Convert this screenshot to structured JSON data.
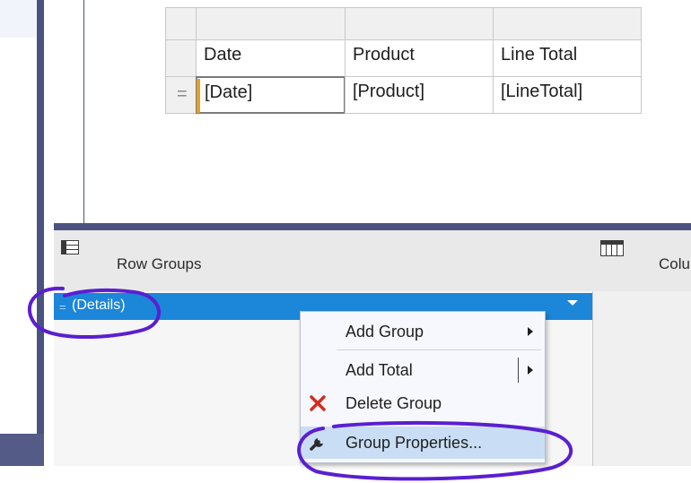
{
  "tablix": {
    "headers": [
      "Date",
      "Product",
      "Line Total"
    ],
    "row": [
      "[Date]",
      "[Product]",
      "[LineTotal]"
    ],
    "row_handle_glyph": "="
  },
  "grouping": {
    "row_groups_label": "Row Groups",
    "column_groups_label": "Colu",
    "details_glyph": "=",
    "details_label": "(Details)"
  },
  "context_menu": {
    "items": [
      {
        "label": "Add Group",
        "icon": "",
        "has_submenu": true
      },
      {
        "label": "Add Total",
        "icon": "",
        "has_submenu": true
      },
      {
        "label": "Delete Group",
        "icon": "red-x-icon",
        "has_submenu": false
      },
      {
        "label": "Group Properties...",
        "icon": "wrench-icon",
        "has_submenu": false,
        "highlighted": true
      }
    ]
  },
  "colors": {
    "frame": "#4a5380",
    "selection": "#1c86d9",
    "menu_highlight": "#c9def5",
    "annotation": "#5a1fd0",
    "delete_icon": "#d42b1e"
  }
}
